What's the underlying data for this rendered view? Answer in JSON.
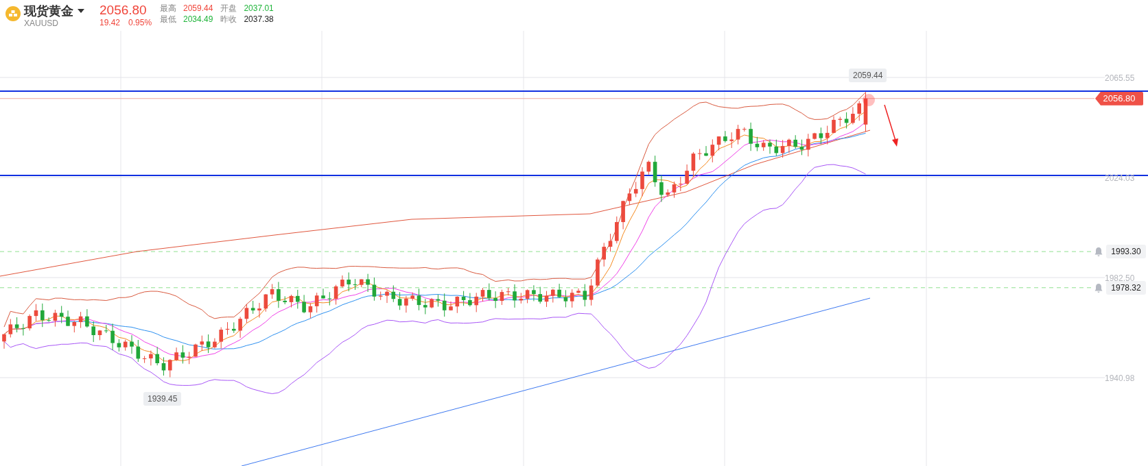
{
  "instrument": {
    "name": "现货黄金",
    "symbol": "XAUUSD",
    "price": "2056.80",
    "change": "19.42",
    "change_percent": "0.95%"
  },
  "stats": [
    {
      "label": "最高",
      "value": "2059.44",
      "color": "#f0453a"
    },
    {
      "label": "开盘",
      "value": "2037.01",
      "color": "#1fb43a"
    },
    {
      "label": "最低",
      "value": "2034.49",
      "color": "#1fb43a"
    },
    {
      "label": "昨收",
      "value": "2037.38",
      "color": "#222222"
    }
  ],
  "price_axis": {
    "ticks": [
      "2065.55",
      "2024.03",
      "1982.50",
      "1940.98"
    ]
  },
  "current_price_tag": "2056.80",
  "high_label": "2059.44",
  "low_label": "1939.45",
  "alerts": [
    {
      "price": "1993.30"
    },
    {
      "price": "1978.32"
    }
  ]
}
